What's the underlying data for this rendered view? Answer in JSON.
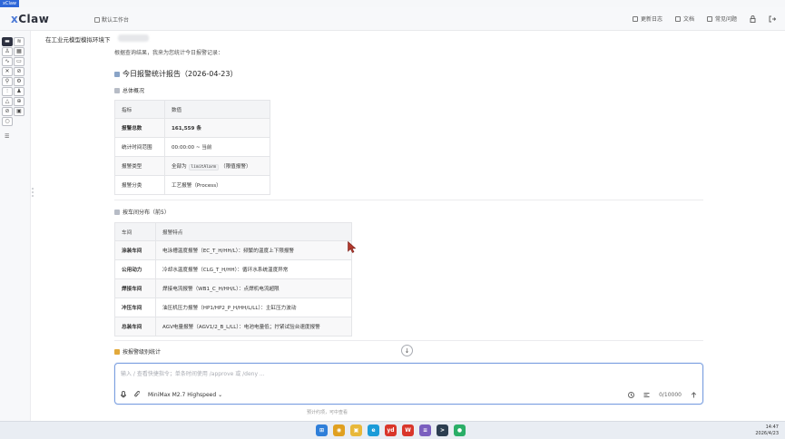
{
  "window": {
    "title_tag": "xClaw"
  },
  "header": {
    "logo": "Claw",
    "logo_prefix": "x",
    "workspace": "默认工作台",
    "right_items": [
      {
        "label": "更新日志",
        "icon": "notes-icon"
      },
      {
        "label": "文档",
        "icon": "doc-icon"
      },
      {
        "label": "常见问题",
        "icon": "help-icon"
      }
    ]
  },
  "sidebar": {
    "icons": [
      "chat-icon",
      "wifi-icon",
      "user-icon",
      "calendar-icon",
      "chart-icon",
      "folder-icon",
      "tool-icon",
      "link-icon",
      "search-icon",
      "plugin-icon",
      "settings-icon",
      "people-icon",
      "warning-icon",
      "globe-icon",
      "stop-icon",
      "image-icon",
      "bulb-icon"
    ]
  },
  "main": {
    "session_title": "在工业元模型模拟环境下",
    "intro": "根据查询结果，我来为您统计今日报警记录：",
    "report_title": "今日报警统计报告（2026-04-23）",
    "overview_title": "总体概况",
    "overview_table": {
      "headers": [
        "指标",
        "数值"
      ],
      "rows": [
        {
          "k": "报警总数",
          "v": "161,559 条",
          "bold": true
        },
        {
          "k": "统计时间范围",
          "v": "00:00:00 ~ 当前",
          "bold": false
        },
        {
          "k": "报警类型",
          "v_pre": "全部为",
          "v_code": "limitAlarm",
          "v_post": "（限值报警）",
          "bold": false
        },
        {
          "k": "报警分类",
          "v": "工艺报警（Process）",
          "bold": false
        }
      ]
    },
    "workshop_title": "按车间分布（前5）",
    "workshop_table": {
      "headers": [
        "车间",
        "报警特点"
      ],
      "rows": [
        {
          "k": "涂装车间",
          "v": "电泳槽温度报警（EC_T_H/HH/L）：频繁的温度上下限报警"
        },
        {
          "k": "公用动力",
          "v": "冷却水温度报警（CLG_T_H/HH）：循环水系统温度异常"
        },
        {
          "k": "焊接车间",
          "v": "焊接电流报警（WB1_C_H/HH/L）：点焊机电流超限"
        },
        {
          "k": "冲压车间",
          "v": "油压机压力报警（HP1/HP2_P_H/HH/L/LL）：主缸压力波动"
        },
        {
          "k": "总装车间",
          "v": "AGV电量报警（AGV1/2_B_L/LL）：电池电量低；拧紧试验台速度报警"
        }
      ]
    },
    "level_title": "按报警级别统计"
  },
  "input": {
    "placeholder": "输入 / 查看快捷指令；单条时间使用 /approve 或 /deny ...",
    "model": "MiniMax M2.7 Highspeed",
    "counter": "0/10000",
    "hint": "预计约项，可中查看"
  },
  "taskbar": {
    "time": "14:47",
    "date": "2026/4/23",
    "apps": [
      {
        "icon": "windows-icon",
        "color": "#2f7fd9",
        "glyph": "⊞"
      },
      {
        "icon": "chrome-icon",
        "color": "#e0a020",
        "glyph": "◉"
      },
      {
        "icon": "files-icon",
        "color": "#e8b83a",
        "glyph": "▣"
      },
      {
        "icon": "edge-icon",
        "color": "#1b9bd8",
        "glyph": "e"
      },
      {
        "icon": "youdao-icon",
        "color": "#d9362b",
        "glyph": "yd"
      },
      {
        "icon": "wps-icon",
        "color": "#d9362b",
        "glyph": "W"
      },
      {
        "icon": "notepad-icon",
        "color": "#7a5fbf",
        "glyph": "≡"
      },
      {
        "icon": "terminal-icon",
        "color": "#2c3e50",
        "glyph": ">"
      },
      {
        "icon": "wechat-icon",
        "color": "#2aae67",
        "glyph": "●"
      }
    ]
  }
}
